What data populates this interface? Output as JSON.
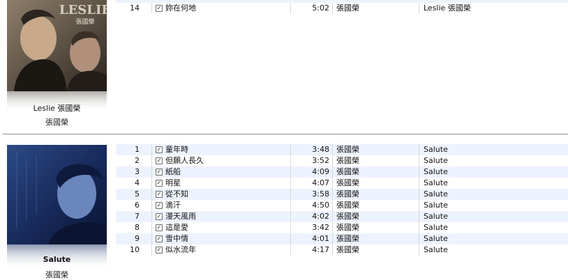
{
  "albums": [
    {
      "title": "Leslie 張國榮",
      "artist": "張國榮",
      "cover_text": "LESLIE",
      "cover_subtext": "張國榮",
      "tracks": [
        {
          "num": "14",
          "checked": true,
          "name": "妳在何地",
          "time": "5:02",
          "artist": "張國榮",
          "album": "Leslie 張國榮"
        }
      ]
    },
    {
      "title": "Salute",
      "artist": "張國榮",
      "tracks": [
        {
          "num": "1",
          "checked": true,
          "name": "童年時",
          "time": "3:48",
          "artist": "張國榮",
          "album": "Salute"
        },
        {
          "num": "2",
          "checked": true,
          "name": "但願人長久",
          "time": "3:52",
          "artist": "張國榮",
          "album": "Salute"
        },
        {
          "num": "3",
          "checked": true,
          "name": "紙船",
          "time": "4:09",
          "artist": "張國榮",
          "album": "Salute"
        },
        {
          "num": "4",
          "checked": true,
          "name": "明星",
          "time": "4:07",
          "artist": "張國榮",
          "album": "Salute"
        },
        {
          "num": "5",
          "checked": true,
          "name": "從不知",
          "time": "3:58",
          "artist": "張國榮",
          "album": "Salute"
        },
        {
          "num": "6",
          "checked": true,
          "name": "滴汗",
          "time": "4:50",
          "artist": "張國榮",
          "album": "Salute"
        },
        {
          "num": "7",
          "checked": true,
          "name": "漫天風雨",
          "time": "4:02",
          "artist": "張國榮",
          "album": "Salute"
        },
        {
          "num": "8",
          "checked": true,
          "name": "這是愛",
          "time": "3:42",
          "artist": "張國榮",
          "album": "Salute"
        },
        {
          "num": "9",
          "checked": true,
          "name": "雪中情",
          "time": "4:01",
          "artist": "張國榮",
          "album": "Salute"
        },
        {
          "num": "10",
          "checked": true,
          "name": "似水流年",
          "time": "4:17",
          "artist": "張國榮",
          "album": "Salute"
        }
      ]
    }
  ],
  "icons": {
    "checkbox": "checkbox-checked-icon"
  }
}
